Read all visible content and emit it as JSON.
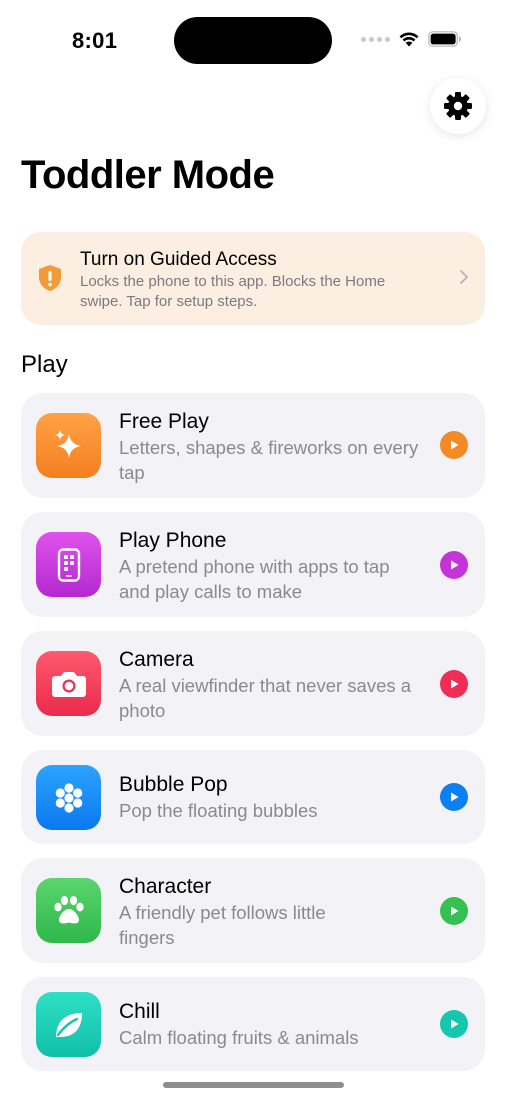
{
  "status_bar": {
    "time": "8:01"
  },
  "page": {
    "title": "Toddler Mode"
  },
  "banner": {
    "title": "Turn on Guided Access",
    "description": "Locks the phone to this app. Blocks the Home swipe. Tap for setup steps.",
    "icon": "shield-exclamation-icon",
    "color": "#f29a38"
  },
  "section": {
    "title": "Play"
  },
  "activities": [
    {
      "title": "Free Play",
      "subtitle": "Letters, shapes & fireworks on every tap",
      "icon": "sparkles-icon",
      "color_from": "#ffa245",
      "color_to": "#f57f20",
      "play_color": "#f28a26"
    },
    {
      "title": "Play Phone",
      "subtitle": "A pretend phone with apps to tap and play calls to make",
      "icon": "phone-device-icon",
      "color_from": "#df52ec",
      "color_to": "#b329cf",
      "play_color": "#c533d9"
    },
    {
      "title": "Camera",
      "subtitle": "A real viewfinder that never saves a photo",
      "icon": "camera-icon",
      "color_from": "#ff5a6e",
      "color_to": "#ea2a4c",
      "play_color": "#ef2e55"
    },
    {
      "title": "Bubble Pop",
      "subtitle": "Pop the floating bubbles",
      "icon": "bubbles-icon",
      "color_from": "#2ea3ff",
      "color_to": "#0a78f0",
      "play_color": "#0c7ff2"
    },
    {
      "title": "Character",
      "subtitle": "A friendly pet follows little fingers",
      "icon": "paw-icon",
      "color_from": "#5bd56f",
      "color_to": "#2fb84b",
      "play_color": "#34c152"
    },
    {
      "title": "Chill",
      "subtitle": "Calm floating fruits & animals",
      "icon": "leaf-icon",
      "color_from": "#2ee0c6",
      "color_to": "#10bfa8",
      "play_color": "#14c7ae"
    }
  ]
}
